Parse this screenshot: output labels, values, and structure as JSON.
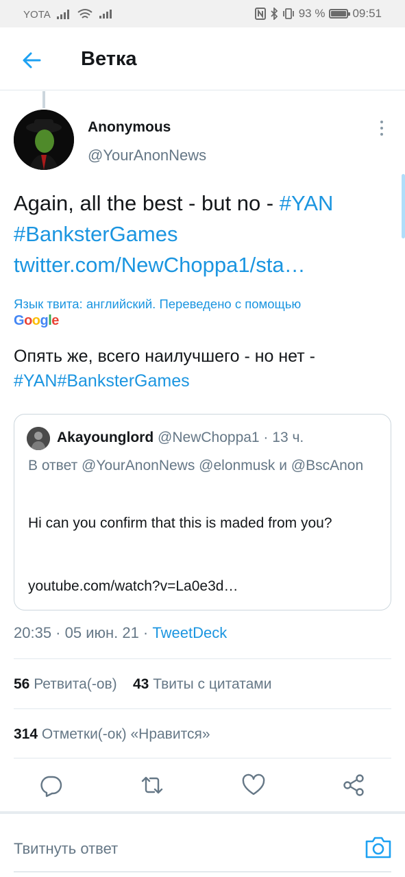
{
  "status_bar": {
    "carrier": "YOTA",
    "battery": "93 %",
    "time": "09:51"
  },
  "header": {
    "title": "Ветка"
  },
  "tweet": {
    "author_name": "Anonymous",
    "author_handle": "@YourAnonNews",
    "text_plain": "Again, all the best - but no - ",
    "hashtag_1": "#YAN",
    "hashtag_2": "#BanksterGames",
    "link": "twitter.com/NewChoppa1/sta…",
    "translation_note": "Язык твита: английский. Переведено с помощью",
    "translated_text": "Опять же, всего наилучшего - но нет -",
    "translated_hashtag_1": "#YAN",
    "translated_hashtag_2": "#BanksterGames"
  },
  "quoted_tweet": {
    "author_name": "Akayounglord",
    "author_handle": "@NewChoppa1 · 13 ч.",
    "reply_to": "В ответ @YourAnonNews @elonmusk и @BscAnon",
    "body": "Hi can you confirm that this is maded from you?",
    "link": "youtube.com/watch?v=La0e3d…"
  },
  "meta": {
    "timestamp": "20:35 · 05 июн. 21 · ",
    "source": "TweetDeck"
  },
  "stats": {
    "retweets_count": "56",
    "retweets_label": "Ретвита(-ов)",
    "quotes_count": "43",
    "quotes_label": "Твиты с цитатами",
    "likes_count": "314",
    "likes_label": "Отметки(-ок) «Нравится»"
  },
  "reply_bar": {
    "placeholder": "Твитнуть ответ"
  },
  "colors": {
    "accent": "#1da1f2",
    "link": "#1b95e0",
    "secondary_text": "#657786"
  }
}
